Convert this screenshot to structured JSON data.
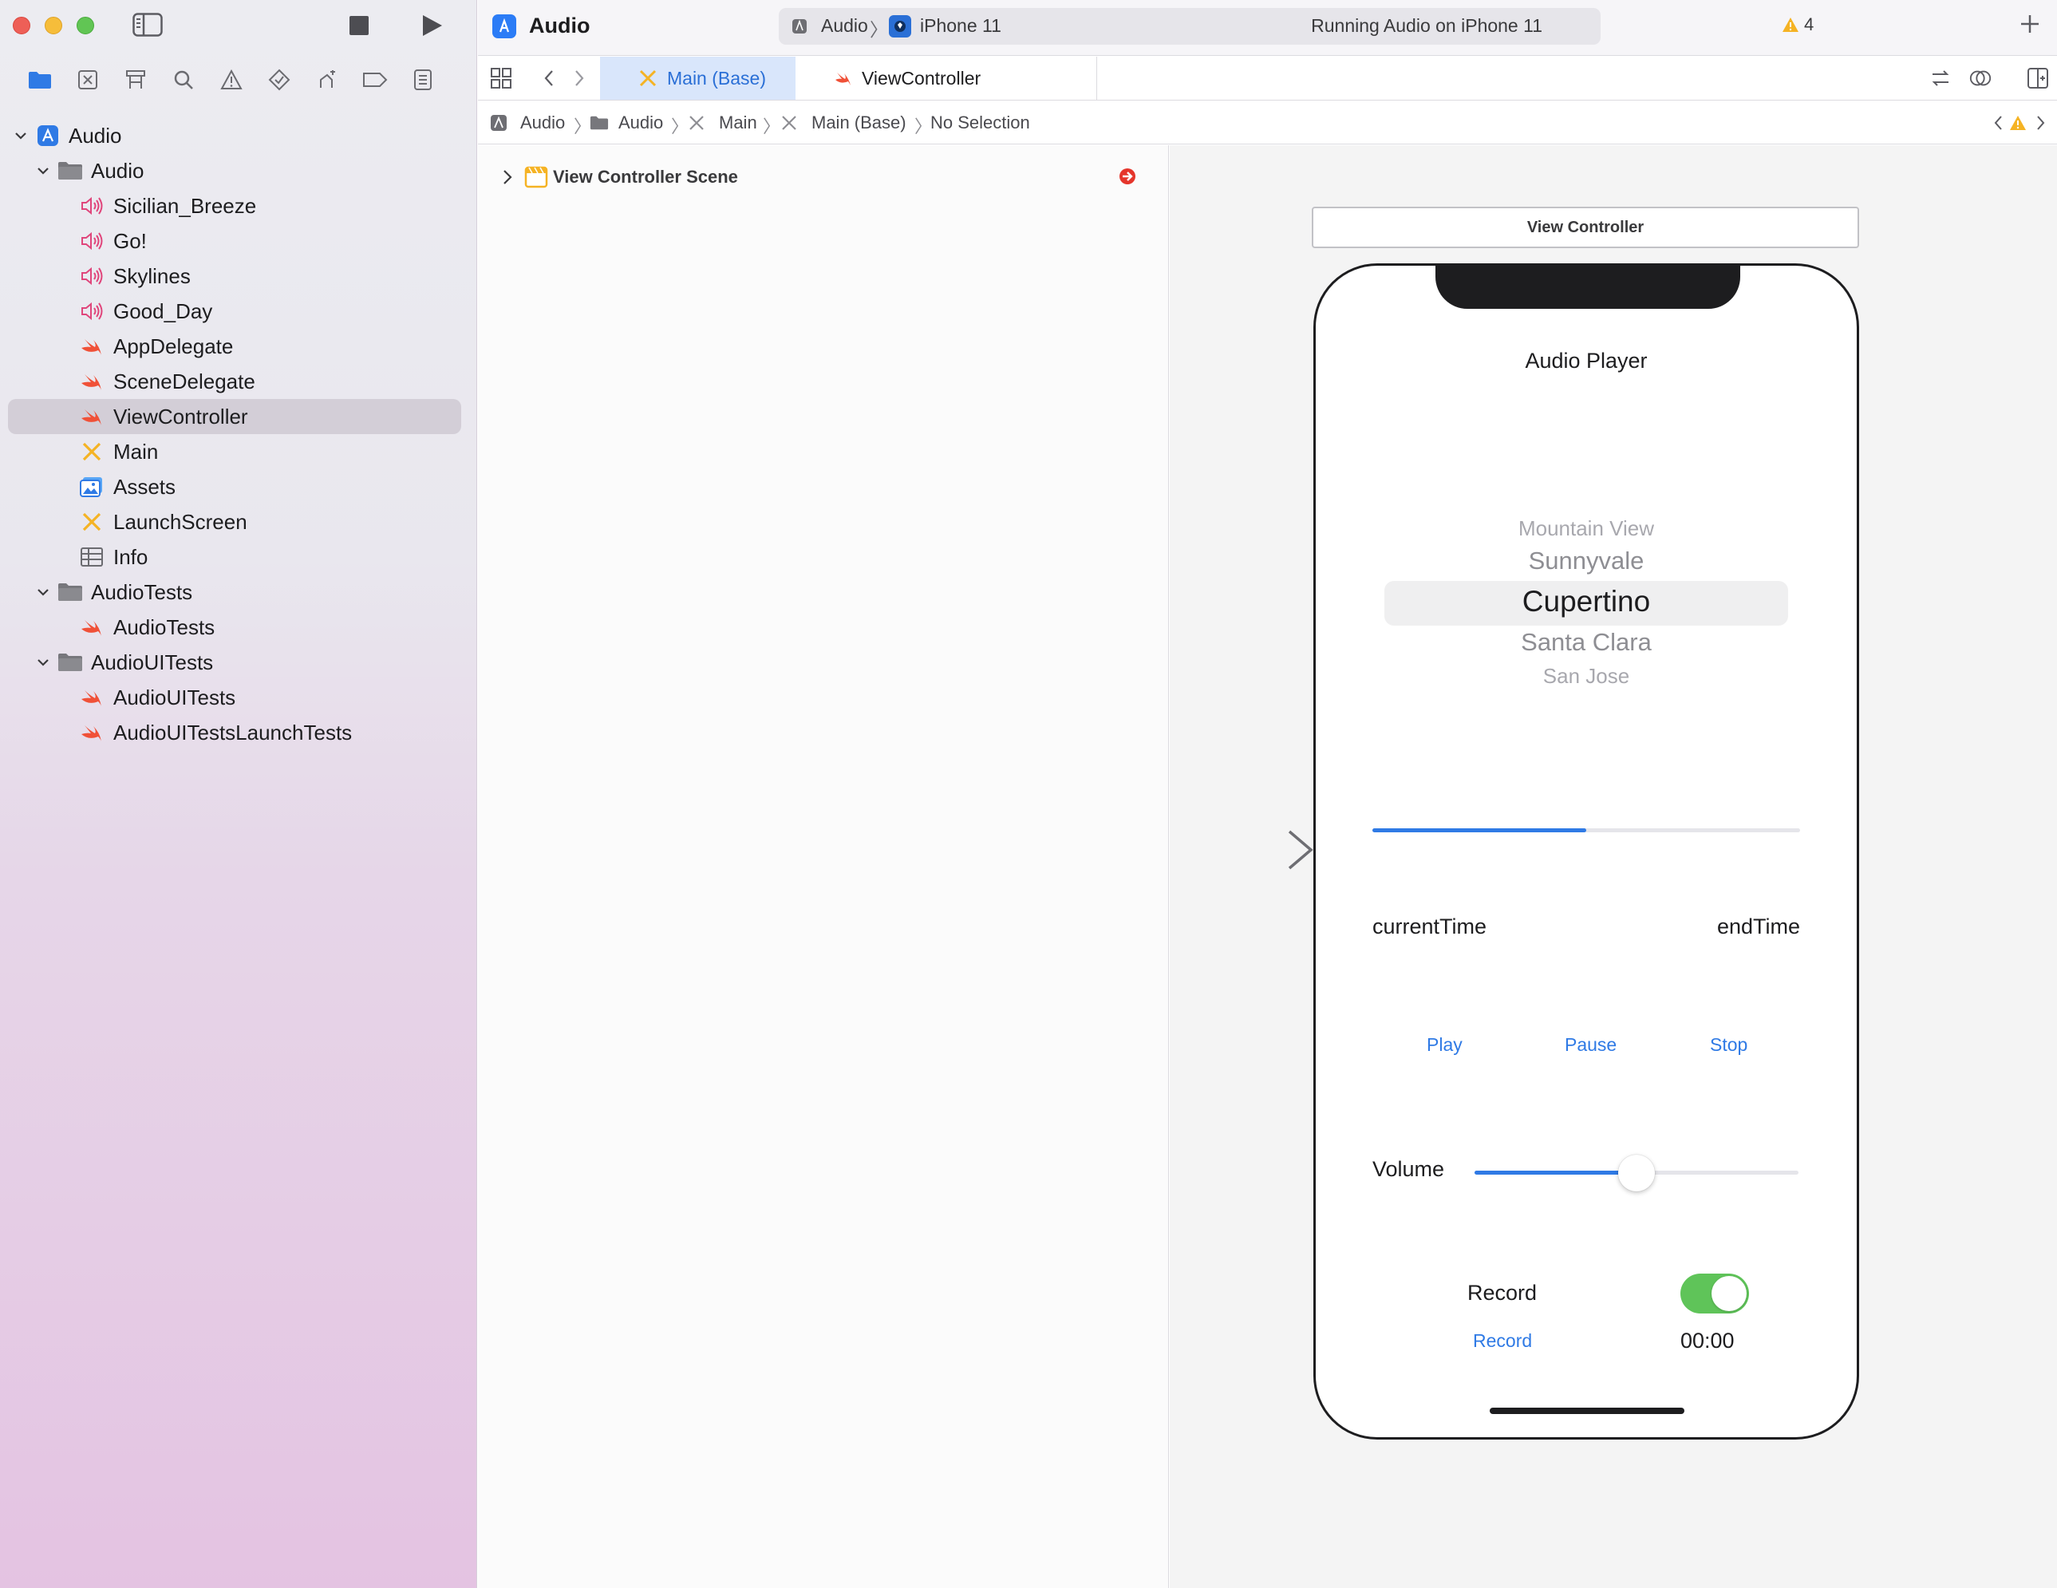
{
  "toolbar": {
    "project_title": "Audio",
    "scheme_app": "Audio",
    "scheme_device": "iPhone 11",
    "status": "Running Audio on iPhone 11",
    "warning_count": "4"
  },
  "navigator": {
    "tree": [
      {
        "label": "Audio",
        "icon": "app-project-icon",
        "level": 0,
        "expanded": true
      },
      {
        "label": "Audio",
        "icon": "folder-icon",
        "level": 1,
        "expanded": true
      },
      {
        "label": "Sicilian_Breeze",
        "icon": "audio-file-icon",
        "level": 2
      },
      {
        "label": "Go!",
        "icon": "audio-file-icon",
        "level": 2
      },
      {
        "label": "Skylines",
        "icon": "audio-file-icon",
        "level": 2
      },
      {
        "label": "Good_Day",
        "icon": "audio-file-icon",
        "level": 2
      },
      {
        "label": "AppDelegate",
        "icon": "swift-file-icon",
        "level": 2
      },
      {
        "label": "SceneDelegate",
        "icon": "swift-file-icon",
        "level": 2
      },
      {
        "label": "ViewController",
        "icon": "swift-file-icon",
        "level": 2,
        "selected": true
      },
      {
        "label": "Main",
        "icon": "storyboard-icon",
        "level": 2
      },
      {
        "label": "Assets",
        "icon": "asset-catalog-icon",
        "level": 2
      },
      {
        "label": "LaunchScreen",
        "icon": "storyboard-icon",
        "level": 2
      },
      {
        "label": "Info",
        "icon": "plist-icon",
        "level": 2
      },
      {
        "label": "AudioTests",
        "icon": "folder-icon",
        "level": 1,
        "expanded": true
      },
      {
        "label": "AudioTests",
        "icon": "swift-file-icon",
        "level": 2
      },
      {
        "label": "AudioUITests",
        "icon": "folder-icon",
        "level": 1,
        "expanded": true
      },
      {
        "label": "AudioUITests",
        "icon": "swift-file-icon",
        "level": 2
      },
      {
        "label": "AudioUITestsLaunchTests",
        "icon": "swift-file-icon",
        "level": 2
      }
    ]
  },
  "tabs": [
    {
      "label": "Main (Base)",
      "icon": "storyboard-icon",
      "active": true
    },
    {
      "label": "ViewController",
      "icon": "swift-file-icon",
      "active": false
    }
  ],
  "breadcrumb": {
    "items": [
      "Audio",
      "Audio",
      "Main",
      "Main (Base)",
      "No Selection"
    ]
  },
  "outline": {
    "scene_label": "View Controller Scene"
  },
  "canvas": {
    "vc_title": "View Controller",
    "app": {
      "title": "Audio Player",
      "picker_items": [
        "Mountain View",
        "Sunnyvale",
        "Cupertino",
        "Santa Clara",
        "San Jose"
      ],
      "picker_selected": "Cupertino",
      "progress": 0.5,
      "current_time_label": "currentTime",
      "end_time_label": "endTime",
      "play_label": "Play",
      "pause_label": "Pause",
      "stop_label": "Stop",
      "volume_label": "Volume",
      "volume_value": 0.5,
      "record_label": "Record",
      "record_switch_on": true,
      "record_button_label": "Record",
      "record_time": "00:00"
    }
  },
  "colors": {
    "accent_blue": "#2f7ae5",
    "switch_green": "#5fc459",
    "swift_orange": "#f05138",
    "audio_pink": "#e0457b",
    "storyboard_yellow": "#f5b324",
    "error_red": "#e5352b"
  }
}
